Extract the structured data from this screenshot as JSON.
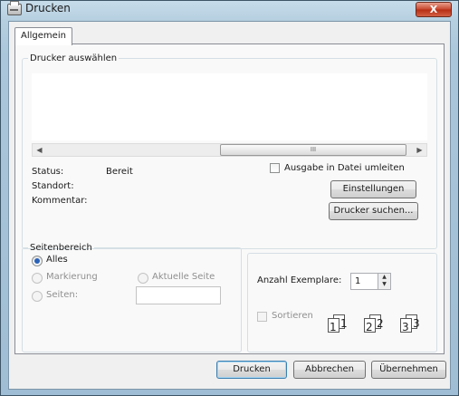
{
  "window": {
    "title": "Drucken",
    "close_label": "X"
  },
  "tabs": [
    {
      "label": "Allgemein"
    }
  ],
  "printer_group": {
    "legend": "Drucker auswählen",
    "scrollbar_grip": "III",
    "status_label": "Status:",
    "status_value": "Bereit",
    "location_label": "Standort:",
    "comment_label": "Kommentar:",
    "print_to_file_label": "Ausgabe in Datei umleiten",
    "settings_button": "Einstellungen",
    "find_printer_button": "Drucker suchen..."
  },
  "page_range": {
    "legend": "Seitenbereich",
    "all_label": "Alles",
    "selection_label": "Markierung",
    "current_page_label": "Aktuelle Seite",
    "pages_label": "Seiten:",
    "pages_value": ""
  },
  "copies": {
    "count_label": "Anzahl Exemplare:",
    "count_value": "1",
    "collate_label": "Sortieren",
    "collate_pages": [
      "1",
      "1",
      "2",
      "2",
      "3",
      "3"
    ]
  },
  "buttons": {
    "print": "Drucken",
    "cancel": "Abbrechen",
    "apply": "Übernehmen"
  }
}
